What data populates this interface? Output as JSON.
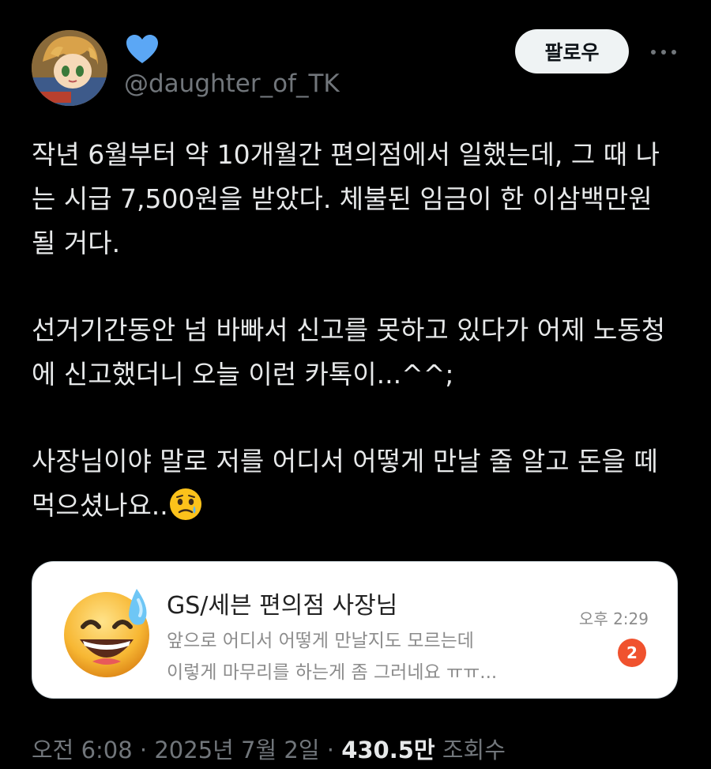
{
  "author": {
    "handle": "@daughter_of_TK",
    "badge_icon": "blue-heart-icon",
    "follow_label": "팔로우"
  },
  "tweet": {
    "paragraphs": [
      "작년 6월부터 약 10개월간 편의점에서 일했는데, 그 때 나는 시급 7,500원을 받았다. 체불된 임금이 한 이삼백만원 될 거다.",
      "선거기간동안 넘 바빠서 신고를 못하고 있다가 어제 노동청에 신고했더니 오늘 이런 카톡이...^^;",
      "사장님이야 말로 저를 어디서 어떻게 만날 줄 알고 돈을 떼먹으셨나요.."
    ],
    "trailing_emoji": "face-holding-back-tears-emoji"
  },
  "chat_card": {
    "sender": "GS/세븐 편의점 사장님",
    "message_line1": "앞으로 어디서 어떻게 만날지도 모르는데",
    "message_line2": "이렇게 마무리를 하는게 좀 그러네요 ㅠㅠ...",
    "time": "오후 2:29",
    "unread_count": "2",
    "avatar_icon": "grinning-face-with-sweat-emoji"
  },
  "meta": {
    "time": "오전 6:08",
    "separator": "·",
    "date": "2025년 7월 2일",
    "views_count": "430.5만",
    "views_label": "조회수"
  },
  "colors": {
    "background": "#000000",
    "text": "#e7e9ea",
    "muted": "#71767b",
    "heart": "#5ba7f5",
    "badge": "#f0522e"
  }
}
